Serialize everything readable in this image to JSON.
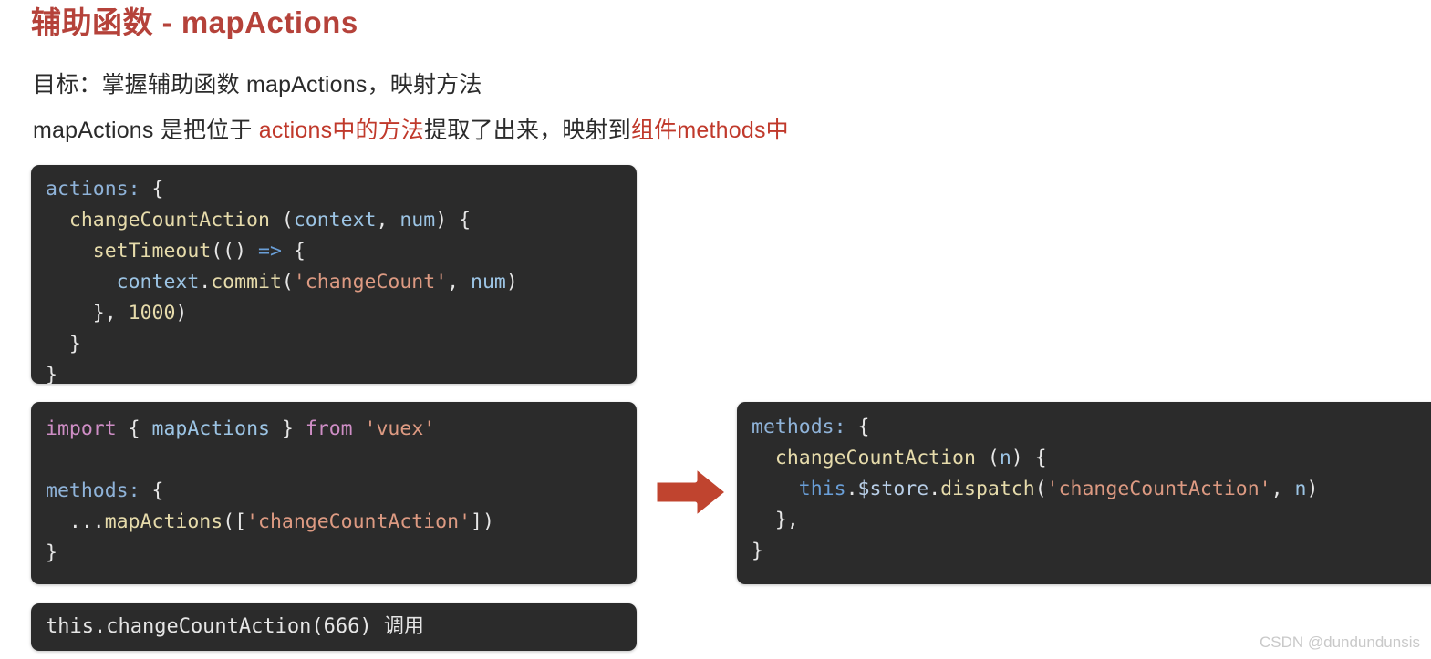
{
  "title": "辅助函数 - mapActions",
  "colors": {
    "title": "#b5423a",
    "highlight_red": "#c0392b",
    "code_background": "#2b2b2b",
    "arrow": "#c0442f",
    "page_background": "#ffffff",
    "watermark": "#c9c9c9"
  },
  "intro": {
    "goal_line": "目标：掌握辅助函数 mapActions，映射方法",
    "desc_prefix": "mapActions 是把位于 ",
    "desc_highlight_1": "actions中的方法",
    "desc_middle": "提取了出来，映射到",
    "desc_highlight_2": "组件methods",
    "desc_suffix": "中"
  },
  "code_actions": {
    "line1_key": "actions:",
    "line1_brace": " {",
    "line2_fn": "changeCountAction",
    "line2_open": " (",
    "line2_p1": "context",
    "line2_comma": ", ",
    "line2_p2": "num",
    "line2_close": ") {",
    "line3_fn": "setTimeout",
    "line3_open": "(() ",
    "line3_arrow": "=>",
    "line3_brace": " {",
    "line4_obj": "context",
    "line4_dot": ".",
    "line4_fn": "commit",
    "line4_open": "(",
    "line4_str": "'changeCount'",
    "line4_comma": ", ",
    "line4_p": "num",
    "line4_close": ")",
    "line5": "}, ",
    "line5_num": "1000",
    "line5_close": ")",
    "line6": "}",
    "line7": "}"
  },
  "code_mapactions": {
    "l1_import": "import",
    "l1_brace_open": " { ",
    "l1_name": "mapActions",
    "l1_brace_close": " } ",
    "l1_from": "from",
    "l1_module": " 'vuex'",
    "l3_key": "methods:",
    "l3_brace": " {",
    "l4_spread": "...",
    "l4_fn": "mapActions",
    "l4_open": "([",
    "l4_str": "'changeCountAction'",
    "l4_close": "])",
    "l5": "}"
  },
  "code_result": {
    "l1_key": "methods:",
    "l1_brace": " {",
    "l2_fn": "changeCountAction",
    "l2_open": " (",
    "l2_param": "n",
    "l2_close": ") {",
    "l3_this": "this",
    "l3_dot1": ".",
    "l3_store": "$store",
    "l3_dot2": ".",
    "l3_fn": "dispatch",
    "l3_open": "(",
    "l3_str": "'changeCountAction'",
    "l3_comma": ", ",
    "l3_param": "n",
    "l3_close": ")",
    "l4": "},",
    "l5": "}"
  },
  "code_call": {
    "text": "this.changeCountAction(666) 调用"
  },
  "arrow": {
    "name": "right-arrow",
    "direction": "right"
  },
  "watermark": {
    "text": "CSDN @dundundunsis"
  }
}
